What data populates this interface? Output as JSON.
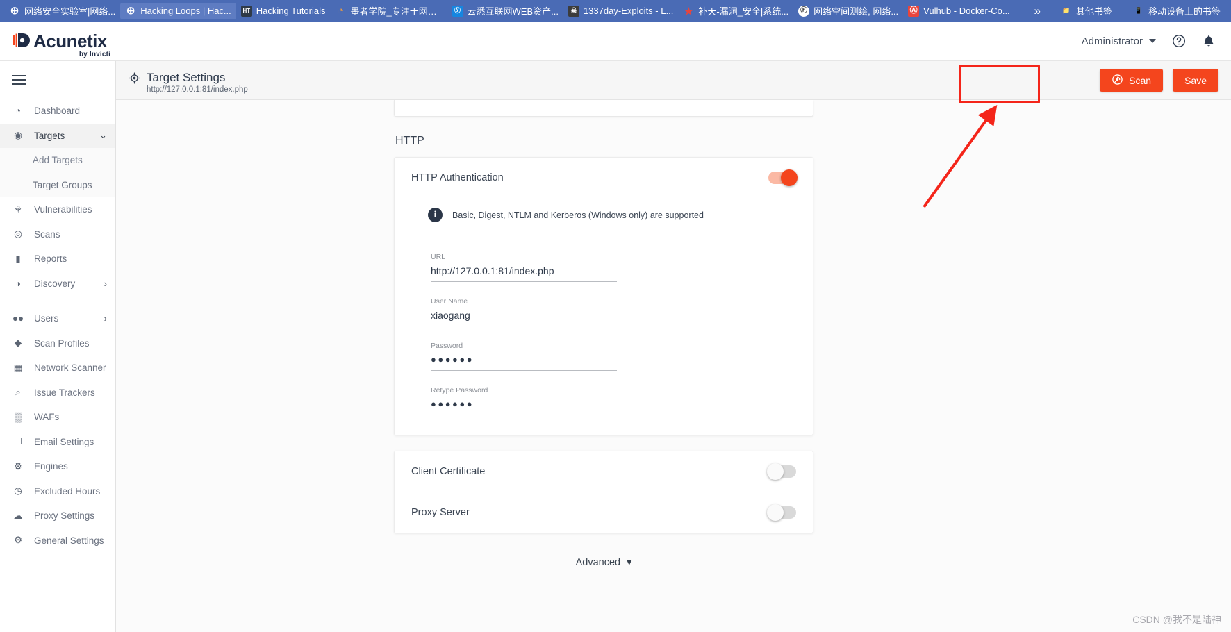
{
  "browser": {
    "bookmarks": [
      {
        "label": "网络安全实验室|网络...",
        "icon": "globe-icon",
        "icon_class": "fav-globe",
        "glyph": "⊕",
        "active": false
      },
      {
        "label": "Hacking Loops | Hac...",
        "icon": "globe-icon",
        "icon_class": "fav-globe",
        "glyph": "⊕",
        "active": true
      },
      {
        "label": "Hacking Tutorials",
        "icon": "ht-icon",
        "icon_class": "fav-ht",
        "glyph": "HT",
        "active": false
      },
      {
        "label": "墨者学院_专注于网络...",
        "icon": "mozhe-icon",
        "icon_class": "fav-mz",
        "glyph": "◔",
        "active": false
      },
      {
        "label": "云悉互联网WEB资产...",
        "icon": "yunxi-icon",
        "icon_class": "fav-ys",
        "glyph": "ⓨ",
        "active": false
      },
      {
        "label": "1337day-Exploits - L...",
        "icon": "skull-icon",
        "icon_class": "fav-1337",
        "glyph": "☠",
        "active": false
      },
      {
        "label": "补天-漏洞_安全|系统...",
        "icon": "butian-icon",
        "icon_class": "fav-bt",
        "glyph": "★",
        "active": false
      },
      {
        "label": "网络空间测绘, 网络...",
        "icon": "fofa-icon",
        "icon_class": "fav-net",
        "glyph": "Ⓕ",
        "active": false
      },
      {
        "label": "Vulhub - Docker-Co...",
        "icon": "vulhub-icon",
        "icon_class": "fav-vh",
        "glyph": "Ⓐ",
        "active": false
      }
    ],
    "overflow_label": "»",
    "other_bookmarks": "其他书签",
    "mobile_bookmarks": "移动设备上的书签"
  },
  "header": {
    "logo_text": "Acunetix",
    "logo_sub": "by Invicti",
    "user": "Administrator",
    "help_icon": "help-circle-icon",
    "bell_icon": "notification-bell-icon"
  },
  "sidebar": {
    "menu_icon": "hamburger-menu-icon",
    "items": [
      {
        "label": "Dashboard",
        "icon": "dashboard-gauge-icon",
        "glyph": "◔",
        "type": "item",
        "active": false,
        "chevron": ""
      },
      {
        "label": "Targets",
        "icon": "target-crosshair-icon",
        "glyph": "◉",
        "type": "item",
        "active": true,
        "chevron": "⌄"
      },
      {
        "label": "Add Targets",
        "type": "sub",
        "highlight": true
      },
      {
        "label": "Target Groups",
        "type": "sub",
        "highlight": false
      },
      {
        "label": "Vulnerabilities",
        "icon": "bug-icon",
        "glyph": "⚘",
        "type": "item",
        "active": false,
        "chevron": ""
      },
      {
        "label": "Scans",
        "icon": "scan-radar-icon",
        "glyph": "◎",
        "type": "item",
        "active": false,
        "chevron": ""
      },
      {
        "label": "Reports",
        "icon": "document-icon",
        "glyph": "▮",
        "type": "item",
        "active": false,
        "chevron": ""
      },
      {
        "label": "Discovery",
        "icon": "compass-icon",
        "glyph": "◑",
        "type": "item",
        "active": false,
        "chevron": "›"
      },
      {
        "label": "",
        "type": "divider"
      },
      {
        "label": "Users",
        "icon": "users-icon",
        "glyph": "●●",
        "type": "item",
        "active": false,
        "chevron": "›"
      },
      {
        "label": "Scan Profiles",
        "icon": "shield-icon",
        "glyph": "◆",
        "type": "item",
        "active": false,
        "chevron": ""
      },
      {
        "label": "Network Scanner",
        "icon": "network-scanner-icon",
        "glyph": "▦",
        "type": "item",
        "active": false,
        "chevron": ""
      },
      {
        "label": "Issue Trackers",
        "icon": "issue-tracker-search-icon",
        "glyph": "⌕",
        "type": "item",
        "active": false,
        "chevron": ""
      },
      {
        "label": "WAFs",
        "icon": "firewall-icon",
        "glyph": "▒",
        "type": "item",
        "active": false,
        "chevron": ""
      },
      {
        "label": "Email Settings",
        "icon": "bell-icon",
        "glyph": "☐",
        "type": "item",
        "active": false,
        "chevron": ""
      },
      {
        "label": "Engines",
        "icon": "chip-icon",
        "glyph": "⚙",
        "type": "item",
        "active": false,
        "chevron": ""
      },
      {
        "label": "Excluded Hours",
        "icon": "clock-icon",
        "glyph": "◷",
        "type": "item",
        "active": false,
        "chevron": ""
      },
      {
        "label": "Proxy Settings",
        "icon": "cloud-proxy-icon",
        "glyph": "☁",
        "type": "item",
        "active": false,
        "chevron": ""
      },
      {
        "label": "General Settings",
        "icon": "gear-icon",
        "glyph": "⚙",
        "type": "item",
        "active": false,
        "chevron": ""
      }
    ]
  },
  "page": {
    "title": "Target Settings",
    "title_icon": "target-crosshair-icon",
    "subtitle": "http://127.0.0.1:81/index.php",
    "scan_button": "Scan",
    "scan_button_icon": "scan-radar-icon",
    "save_button": "Save"
  },
  "content": {
    "section_title": "HTTP",
    "http_auth": {
      "label": "HTTP Authentication",
      "toggle_state": "on",
      "info_icon": "info-icon",
      "info_text": "Basic, Digest, NTLM and Kerberos (Windows only) are supported",
      "fields": [
        {
          "label": "URL",
          "value": "http://127.0.0.1:81/index.php",
          "masked": false
        },
        {
          "label": "User Name",
          "value": "xiaogang",
          "masked": false
        },
        {
          "label": "Password",
          "value": "●●●●●●",
          "masked": true
        },
        {
          "label": "Retype Password",
          "value": "●●●●●●",
          "masked": true
        }
      ]
    },
    "rows": [
      {
        "label": "Client Certificate",
        "toggle_state": "off"
      },
      {
        "label": "Proxy Server",
        "toggle_state": "off"
      }
    ],
    "advanced_label": "Advanced",
    "advanced_caret": "▾"
  },
  "watermark": "CSDN @我不是陆神",
  "colors": {
    "accent": "#f4451d",
    "bookmark_bar": "#4a6bb5",
    "highlight_border": "#f4251a"
  }
}
